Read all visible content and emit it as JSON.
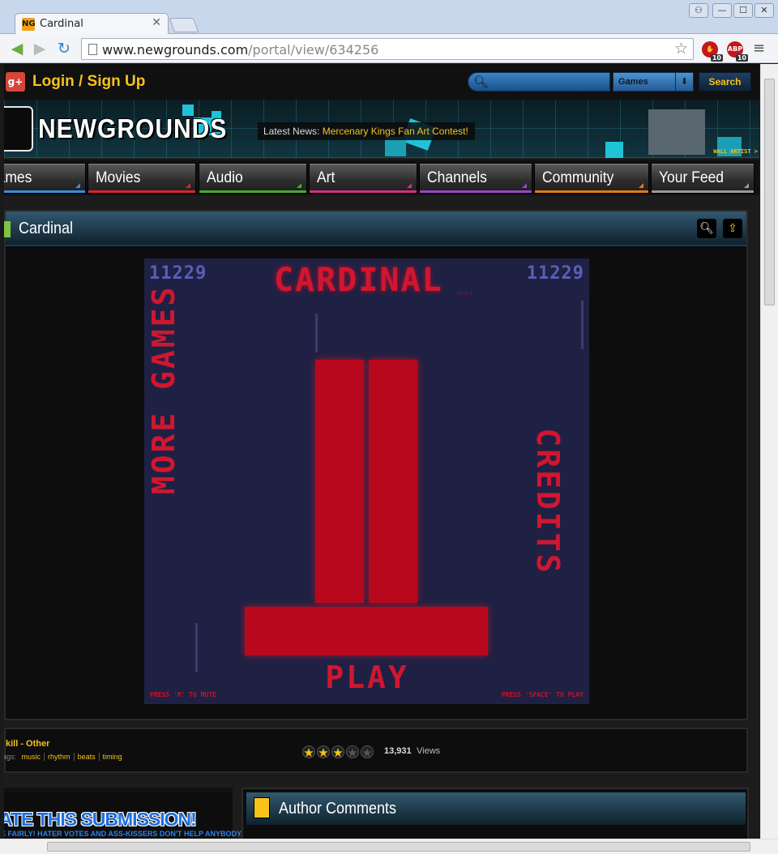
{
  "browser": {
    "tab_title": "Cardinal",
    "tab_favicon": "NG",
    "url_host": "www.newgrounds.com",
    "url_path": "/portal/view/634256",
    "ext_adblock_label": "ABP",
    "ext_stop_count": "10",
    "ext_abp_count": "10"
  },
  "header": {
    "gplus": "g+",
    "login_label": "Login / Sign Up",
    "search_placeholder": "",
    "search_scope": "Games",
    "search_button": "Search"
  },
  "banner": {
    "logo": "NEWGROUNDS",
    "news_prefix": "Latest News:",
    "news_link": "Mercenary Kings Fan Art Contest!",
    "wall_artist": "WALL ARTIST >"
  },
  "nav": {
    "items": [
      {
        "label": "Games",
        "color": "#3d8be0"
      },
      {
        "label": "Movies",
        "color": "#d8262f"
      },
      {
        "label": "Audio",
        "color": "#4aa830"
      },
      {
        "label": "Art",
        "color": "#d62f86"
      },
      {
        "label": "Channels",
        "color": "#9b46c9"
      },
      {
        "label": "Community",
        "color": "#e07a18"
      },
      {
        "label": "Your Feed",
        "color": "#9a9a9a"
      }
    ]
  },
  "submission": {
    "title": "Cardinal",
    "game": {
      "score_left": "11229",
      "score_right": "11229",
      "title": "CARDINAL",
      "version": "v1.0.1",
      "more_games": "MORE GAMES",
      "credits": "CREDITS",
      "play": "PLAY",
      "hint_mute": "PRESS 'M' TO MUTE",
      "hint_play": "PRESS 'SPACE' TO PLAY"
    },
    "genre": "kill - Other",
    "tags_label": "ags:",
    "tags": [
      "music",
      "rhythm",
      "beats",
      "timing"
    ],
    "rating_stars": 3,
    "views_count": "13,931",
    "views_label": "Views"
  },
  "lower": {
    "rate_title": "ATE THIS SUBMISSION!",
    "rate_subtitle": "E FAIRLY! HATER VOTES AND ASS-KISSERS DON'T HELP ANYBODY.",
    "comments_title": "Author Comments"
  }
}
